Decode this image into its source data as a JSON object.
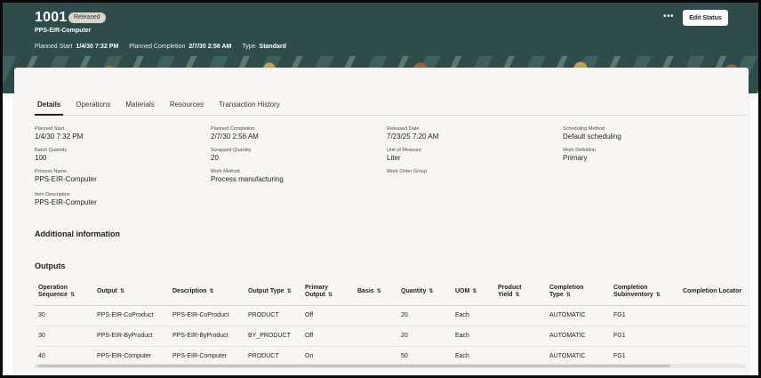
{
  "header": {
    "work_order": "1001",
    "status": "Released",
    "item": "PPS-EIR-Computer",
    "meta": [
      {
        "label": "Planned Start",
        "value": "1/4/30 7:32 PM"
      },
      {
        "label": "Planned Completion",
        "value": "2/7/30 2:56 AM"
      },
      {
        "label": "Type",
        "value": "Standard"
      }
    ],
    "more_label": "•••",
    "edit_status_label": "Edit Status"
  },
  "tabs": [
    "Details",
    "Operations",
    "Materials",
    "Resources",
    "Transaction History"
  ],
  "details": {
    "planned_start": {
      "label": "Planned Start",
      "value": "1/4/30 7:32 PM"
    },
    "batch_quantity": {
      "label": "Batch Quantity",
      "value": "100"
    },
    "process_name": {
      "label": "Process Name",
      "value": "PPS-EIR-Computer"
    },
    "item_description": {
      "label": "Item Description",
      "value": "PPS-EIR-Computer"
    },
    "planned_completion": {
      "label": "Planned Completion",
      "value": "2/7/30 2:56 AM"
    },
    "scrapped_quantity": {
      "label": "Scrapped Quantity",
      "value": "20"
    },
    "work_method": {
      "label": "Work Method",
      "value": "Process manufacturing"
    },
    "released_date": {
      "label": "Released Date",
      "value": "7/23/25 7:20 AM"
    },
    "unit_of_measure": {
      "label": "Unit of Measure",
      "value": "Liter"
    },
    "work_order_group": {
      "label": "Work Order Group",
      "value": ""
    },
    "scheduling_method": {
      "label": "Scheduling Method",
      "value": "Default scheduling"
    },
    "work_definition": {
      "label": "Work Definition",
      "value": "Primary"
    }
  },
  "sections": {
    "additional_information": "Additional information",
    "outputs": "Outputs"
  },
  "outputs": {
    "columns": [
      {
        "label": "Operation Sequence",
        "sortable": true
      },
      {
        "label": "Output",
        "sortable": true
      },
      {
        "label": "Description",
        "sortable": true
      },
      {
        "label": "Output Type",
        "sortable": true
      },
      {
        "label": "Primary Output",
        "sortable": true
      },
      {
        "label": "Basis",
        "sortable": true
      },
      {
        "label": "Quantity",
        "sortable": true
      },
      {
        "label": "UOM",
        "sortable": true
      },
      {
        "label": "Product Yield",
        "sortable": true
      },
      {
        "label": "Completion Type",
        "sortable": true
      },
      {
        "label": "Completion Subinventory",
        "sortable": true
      },
      {
        "label": "Completion Locator",
        "sortable": false
      }
    ],
    "rows": [
      [
        "30",
        "PPS-EIR-CoProduct",
        "PPS-EIR-CoProduct",
        "PRODUCT",
        "Off",
        "",
        "20",
        "Each",
        "",
        "AUTOMATIC",
        "FG1",
        ""
      ],
      [
        "30",
        "PPS-EIR-ByProduct",
        "PPS-EIR-ByProduct",
        "BY_PRODUCT",
        "Off",
        "",
        "20",
        "Each",
        "",
        "AUTOMATIC",
        "FG1",
        ""
      ],
      [
        "40",
        "PPS-EIR-Computer",
        "PPS-EIR-Computer",
        "PRODUCT",
        "On",
        "",
        "50",
        "Each",
        "",
        "AUTOMATIC",
        "FG1",
        ""
      ]
    ]
  },
  "icons": {
    "sort": "sort-icon",
    "more": "more-options-icon"
  },
  "colors": {
    "header_bg": "#2e4c49",
    "card_bg": "#f7f6f4",
    "badge_bg": "#d9d4cc"
  }
}
